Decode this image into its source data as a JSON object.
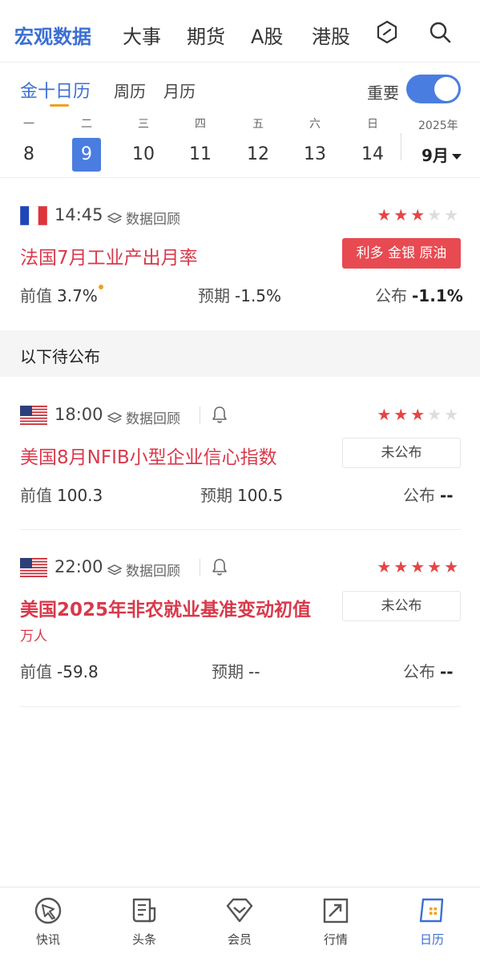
{
  "top_nav": {
    "tabs": [
      "宏观数据",
      "大事",
      "期货",
      "A股",
      "港股"
    ],
    "active_tab": "宏观数据",
    "icons": [
      "hexagon-icon",
      "search-icon"
    ]
  },
  "sub_tabs": {
    "items": [
      "金十日历",
      "周历",
      "月历"
    ],
    "active": "金十日历",
    "important_label": "重要",
    "important_on": true
  },
  "date_strip": {
    "days": [
      {
        "weekday": "一",
        "date": "8"
      },
      {
        "weekday": "二",
        "date": "9"
      },
      {
        "weekday": "三",
        "date": "10"
      },
      {
        "weekday": "四",
        "date": "11"
      },
      {
        "weekday": "五",
        "date": "12"
      },
      {
        "weekday": "六",
        "date": "13"
      },
      {
        "weekday": "日",
        "date": "14"
      }
    ],
    "selected_date": "9",
    "year": "2025年",
    "month": "9月"
  },
  "events": [
    {
      "country": "France",
      "time": "14:45",
      "review_label": "数据回顾",
      "stars": 3,
      "title": "法国7月工业产出月率",
      "tag": "利多 金银 原油",
      "prev_label": "前值",
      "prev": "3.7%",
      "forecast_label": "预期",
      "forecast": "-1.5%",
      "actual_label": "公布",
      "actual": "-1.1%"
    },
    {
      "country": "United States",
      "time": "18:00",
      "review_label": "数据回顾",
      "stars": 3,
      "title": "美国8月NFIB小型企业信心指数",
      "status": "未公布",
      "prev_label": "前值",
      "prev": "100.3",
      "forecast_label": "预期",
      "forecast": "100.5",
      "actual_label": "公布",
      "actual": "--"
    },
    {
      "country": "United States",
      "time": "22:00",
      "review_label": "数据回顾",
      "stars": 5,
      "title": "美国2025年非农就业基准变动初值",
      "unit": "万人",
      "status": "未公布",
      "prev_label": "前值",
      "prev": "-59.8",
      "forecast_label": "预期",
      "forecast": "--",
      "actual_label": "公布",
      "actual": "--"
    }
  ],
  "section_pending": "以下待公布",
  "bottom_nav": {
    "items": [
      "快讯",
      "头条",
      "会员",
      "行情",
      "日历"
    ],
    "active": "日历"
  },
  "colors": {
    "accent_blue": "#3b6fd4",
    "event_red": "#d9394b",
    "star_red": "#e54545",
    "badge_red": "#e84a52",
    "underline_orange": "#f0a020"
  }
}
